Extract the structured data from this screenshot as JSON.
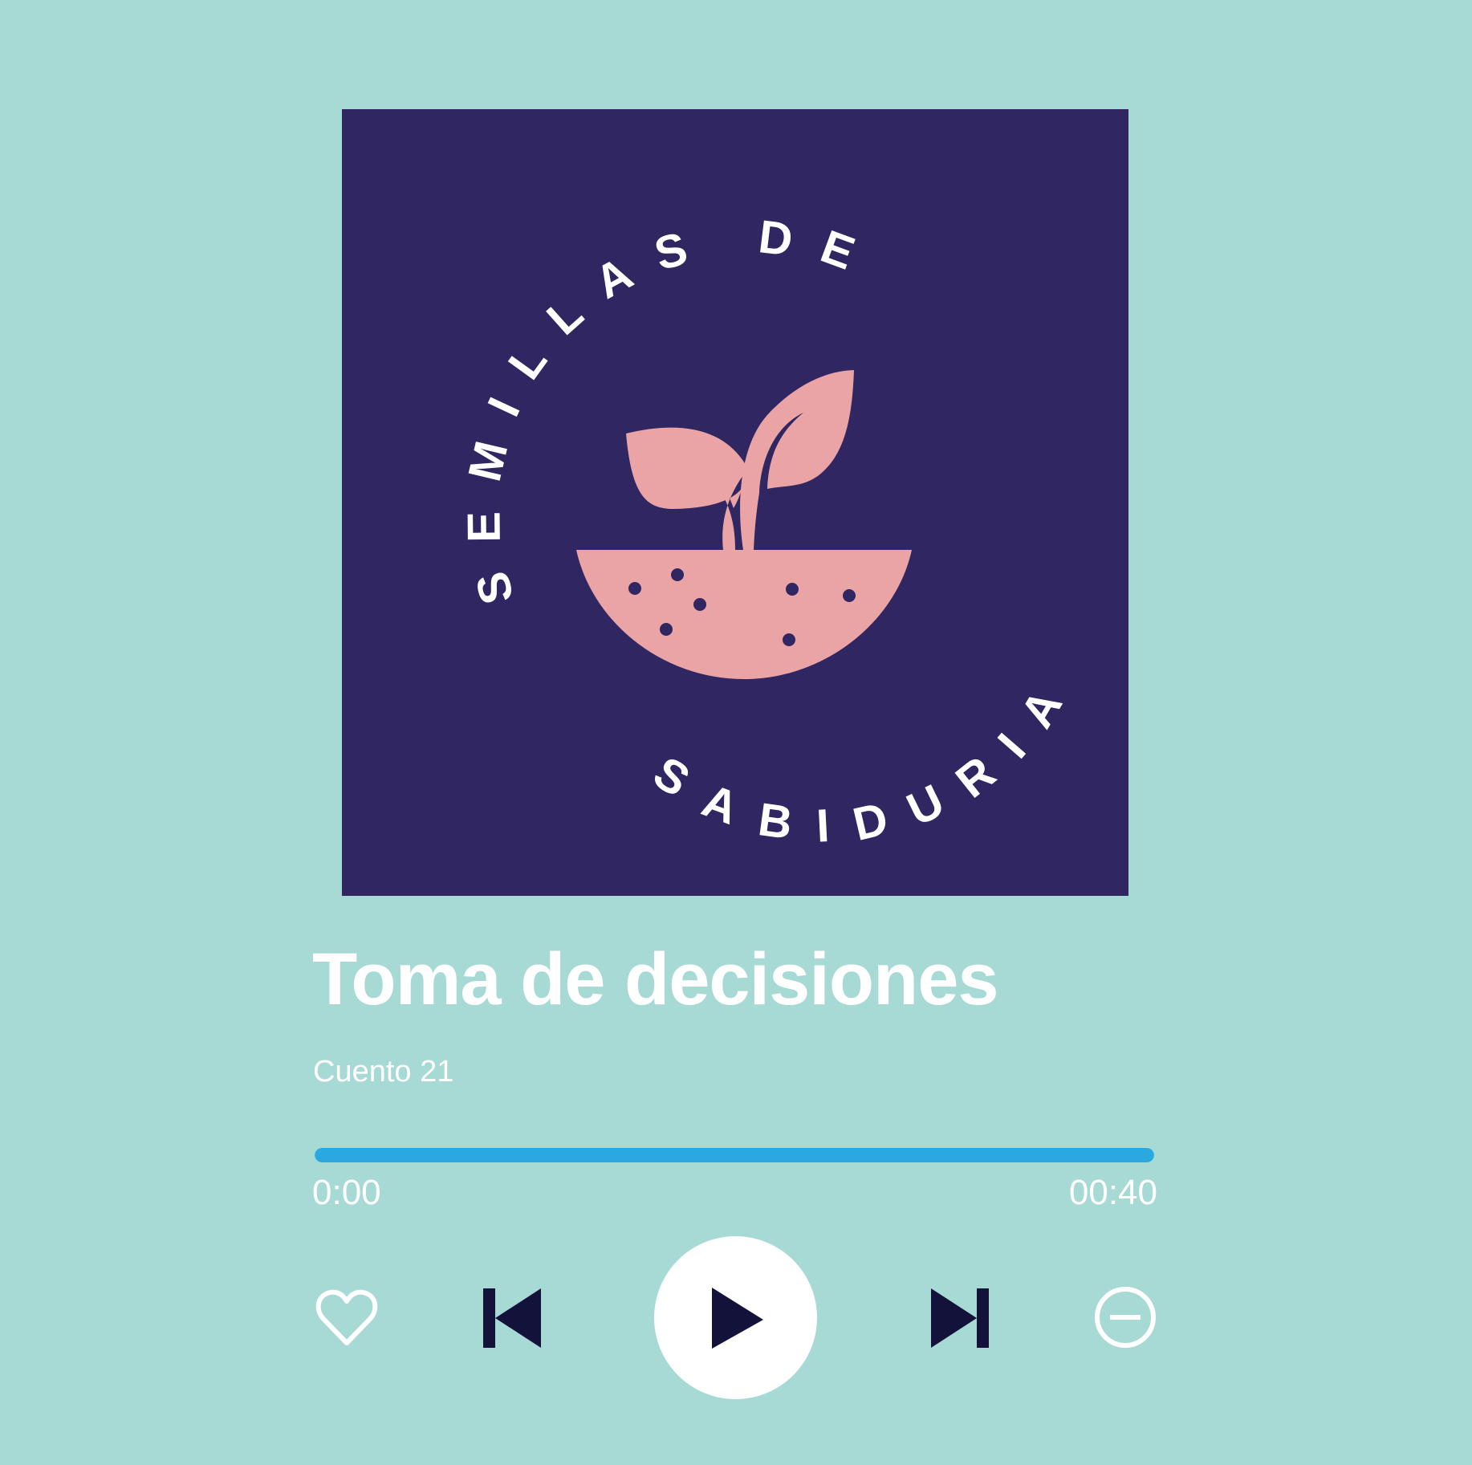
{
  "cover": {
    "logo_text_top": "SEMILLAS DE",
    "logo_text_bottom": "SABIDURIA",
    "background": "#302661",
    "accent": "#eba4a6"
  },
  "track": {
    "title": "Toma de decisiones",
    "subtitle": "Cuento 21"
  },
  "progress": {
    "current_time": "0:00",
    "total_time": "00:40",
    "fraction": 1.0,
    "color": "#29a9e0"
  },
  "controls": {
    "favorite_icon": "heart-outline-icon",
    "previous_icon": "skip-previous-icon",
    "play_icon": "play-icon",
    "next_icon": "skip-next-icon",
    "remove_icon": "minus-circle-icon"
  }
}
